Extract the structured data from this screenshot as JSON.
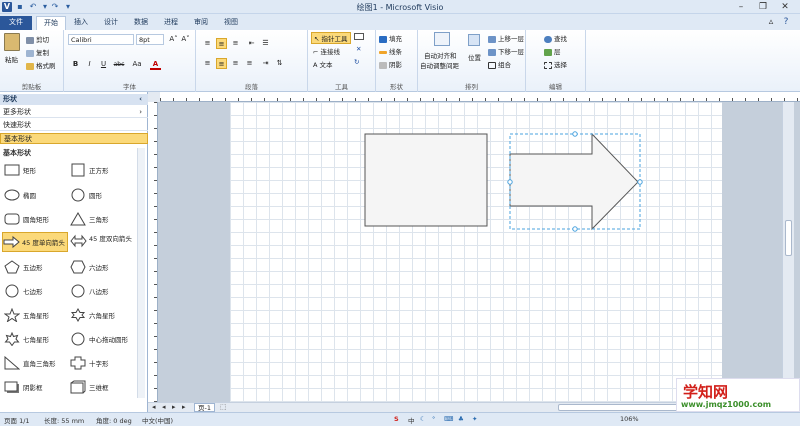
{
  "app": {
    "title": "绘图1 - Microsoft Visio"
  },
  "tabs": [
    "文件",
    "开始",
    "插入",
    "设计",
    "数据",
    "进程",
    "审阅",
    "视图"
  ],
  "ribbon": {
    "clipboard": {
      "paste": "粘贴",
      "cut": "剪切",
      "copy": "复制",
      "format_painter": "格式刷",
      "label": "剪贴板"
    },
    "font": {
      "family": "Calibri",
      "size": "8pt",
      "label": "字体",
      "bold": "B",
      "italic": "I",
      "underline": "U",
      "strike": "abc",
      "case": "Aa",
      "color_letter": "A",
      "grow": "A˄",
      "shrink": "A˅"
    },
    "paragraph": {
      "label": "段落"
    },
    "tools": {
      "pointer": "指针工具",
      "connector": "连接线",
      "text": "文本",
      "label": "工具"
    },
    "shape": {
      "fill": "填充",
      "line": "线条",
      "shadow": "阴影",
      "label": "形状"
    },
    "arrange": {
      "auto_align": "自动对齐和",
      "auto_space": "自动调整间距",
      "position": "位置",
      "bring_forward": "上移一层",
      "send_backward": "下移一层",
      "group": "组合",
      "label": "排列"
    },
    "editing": {
      "find": "查找",
      "layers": "层",
      "select": "选择",
      "label": "编辑"
    }
  },
  "shapes_pane": {
    "title": "形状",
    "more_shapes": "更多形状",
    "quick_shapes": "快速形状",
    "basic_shapes": "基本形状",
    "section_title": "基本形状",
    "items": [
      {
        "label": "矩形"
      },
      {
        "label": "正方形"
      },
      {
        "label": "椭圆"
      },
      {
        "label": "圆形"
      },
      {
        "label": "圆角矩形"
      },
      {
        "label": "三角形"
      },
      {
        "label": "45 度单向箭头"
      },
      {
        "label": "45 度双向箭头"
      },
      {
        "label": "五边形"
      },
      {
        "label": "六边形"
      },
      {
        "label": "七边形"
      },
      {
        "label": "八边形"
      },
      {
        "label": "五角星形"
      },
      {
        "label": "六角星形"
      },
      {
        "label": "七角星形"
      },
      {
        "label": "中心拖动圆形"
      },
      {
        "label": "直角三角形"
      },
      {
        "label": "十字形"
      },
      {
        "label": "阴影框"
      },
      {
        "label": "三维框"
      }
    ]
  },
  "page_tab": "页-1",
  "status": {
    "page": "页面 1/1",
    "length": "长度: 55 mm",
    "angle": "角度: 0 deg",
    "language": "中文(中国)",
    "zoom": "106%"
  },
  "watermark": {
    "line1": "学知网",
    "line2": "www.jmqz1000.com"
  },
  "colors": {
    "accent": "#2b579a",
    "selection": "#4aa3df"
  }
}
